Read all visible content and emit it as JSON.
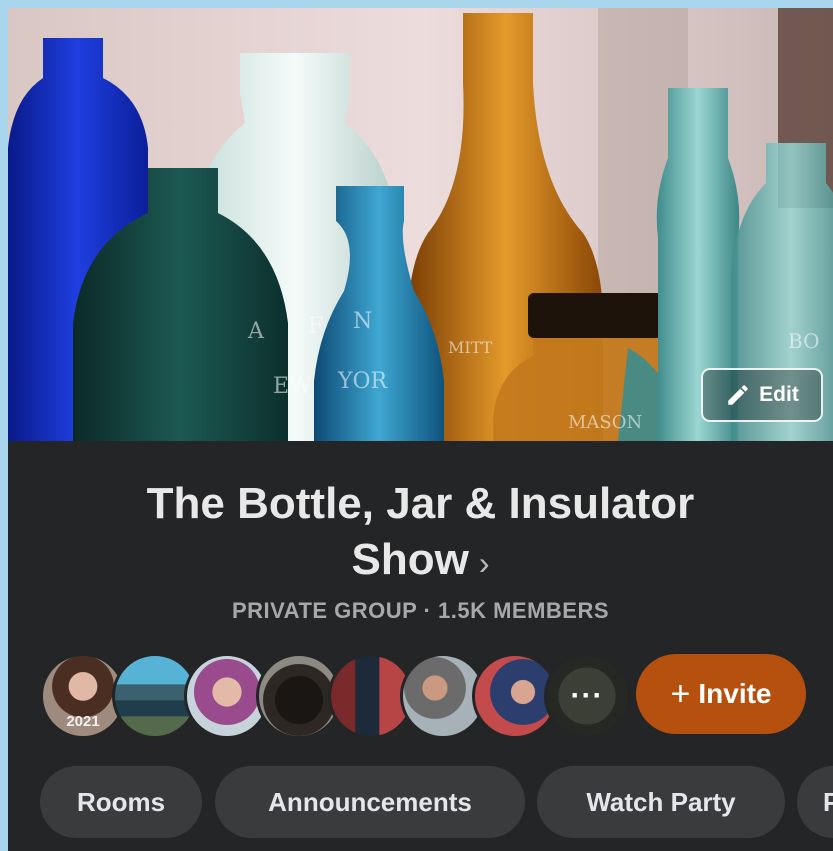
{
  "cover": {
    "edit_label": "Edit"
  },
  "group": {
    "title_line1": "The Bottle, Jar & Insulator",
    "title_line2": "Show",
    "meta": "PRIVATE GROUP · 1.5K MEMBERS"
  },
  "members": {
    "first_avatar_tag": "2021",
    "more_label": "···",
    "invite_label": "Invite",
    "invite_icon": "+"
  },
  "tabs": [
    {
      "label": "Rooms"
    },
    {
      "label": "Announcements"
    },
    {
      "label": "Watch Party"
    },
    {
      "label": "P"
    }
  ],
  "colors": {
    "background": "#242526",
    "invite_accent": "#b5500f",
    "tab_bg": "#3a3b3c",
    "outer_border": "#a9d6ec"
  }
}
